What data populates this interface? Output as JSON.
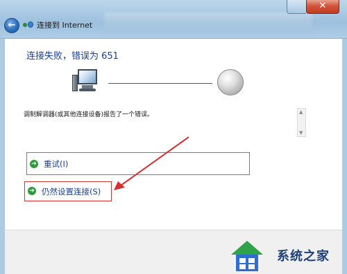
{
  "window": {
    "title": "连接到 Internet",
    "close_label": "✕"
  },
  "main": {
    "heading": "连接失败，错误为 651",
    "error_message": "调制解调器(或其他连接设备)报告了一个错误。",
    "options": {
      "retry_label": "重试(I)",
      "force_label": "仍然设置连接(S)"
    }
  },
  "watermark": {
    "text": "系统之家"
  },
  "colors": {
    "heading": "#1a3f8f",
    "annotation": "#d43030",
    "arrow_green": "#2e9a3b"
  }
}
